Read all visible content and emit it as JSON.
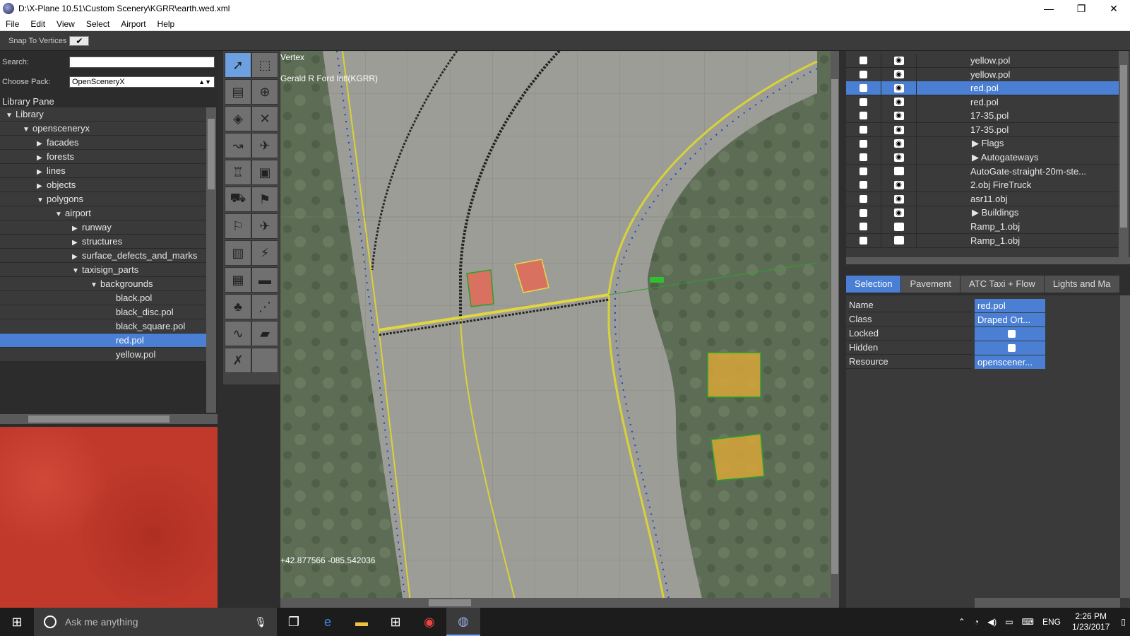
{
  "window": {
    "title": "D:\\X-Plane 10.51\\Custom Scenery\\KGRR\\earth.wed.xml",
    "min": "—",
    "max": "❐",
    "close": "✕"
  },
  "menu": [
    "File",
    "Edit",
    "View",
    "Select",
    "Airport",
    "Help"
  ],
  "toolbar": {
    "snap_label": "Snap To Vertices",
    "snap_checked": "✔"
  },
  "library": {
    "search_label": "Search:",
    "search_value": "",
    "pack_label": "Choose Pack:",
    "pack_value": "OpenSceneryX",
    "pane_title": "Library Pane",
    "items": [
      {
        "label": "Library",
        "tri": "▼"
      },
      {
        "label": "opensceneryx",
        "tri": "▼"
      },
      {
        "label": "facades",
        "tri": "▶"
      },
      {
        "label": "forests",
        "tri": "▶"
      },
      {
        "label": "lines",
        "tri": "▶"
      },
      {
        "label": "objects",
        "tri": "▶"
      },
      {
        "label": "polygons",
        "tri": "▼"
      },
      {
        "label": "airport",
        "tri": "▼"
      },
      {
        "label": "runway",
        "tri": "▶"
      },
      {
        "label": "structures",
        "tri": "▶"
      },
      {
        "label": "surface_defects_and_marks",
        "tri": "▶"
      },
      {
        "label": "taxisign_parts",
        "tri": "▼"
      },
      {
        "label": "backgrounds",
        "tri": "▼"
      },
      {
        "label": "black.pol",
        "tri": ""
      },
      {
        "label": "black_disc.pol",
        "tri": ""
      },
      {
        "label": "black_square.pol",
        "tri": ""
      },
      {
        "label": "red.pol",
        "tri": ""
      },
      {
        "label": "yellow.pol",
        "tri": ""
      }
    ]
  },
  "map": {
    "tool_name": "Vertex",
    "airport_name": "Gerald R Ford Intl(KGRR)",
    "coords": "+42.877566 -085.542036"
  },
  "hierarchy": {
    "rows": [
      {
        "name": "yellow.pol",
        "visible": true
      },
      {
        "name": "yellow.pol",
        "visible": true
      },
      {
        "name": "red.pol",
        "visible": true
      },
      {
        "name": "red.pol",
        "visible": true
      },
      {
        "name": "17-35.pol",
        "visible": true
      },
      {
        "name": "17-35.pol",
        "visible": true
      },
      {
        "name": "▶ Flags",
        "visible": true
      },
      {
        "name": "▶ Autogateways",
        "visible": true
      },
      {
        "name": "AutoGate-straight-20m-ste...",
        "visible": false
      },
      {
        "name": "2.obj FireTruck",
        "visible": true
      },
      {
        "name": "asr11.obj",
        "visible": true
      },
      {
        "name": "▶ Buildings",
        "visible": true
      },
      {
        "name": "Ramp_1.obj",
        "visible": false
      },
      {
        "name": "Ramp_1.obj",
        "visible": false
      }
    ]
  },
  "tabs": [
    "Selection",
    "Pavement",
    "ATC Taxi + Flow",
    "Lights and Ma"
  ],
  "properties": [
    {
      "key": "Name",
      "value": "red.pol"
    },
    {
      "key": "Class",
      "value": "Draped Ort..."
    },
    {
      "key": "Locked",
      "value": ""
    },
    {
      "key": "Hidden",
      "value": "👁"
    },
    {
      "key": "Resource",
      "value": "openscener..."
    }
  ],
  "taskbar": {
    "search_placeholder": "Ask me anything",
    "lang": "ENG",
    "time": "2:26 PM",
    "date": "1/23/2017"
  },
  "colors": {
    "accent": "#4a7fd4",
    "preview": "#c0392b",
    "polygon_red": "#e46a56",
    "polygon_yellow": "#d7a63a"
  }
}
